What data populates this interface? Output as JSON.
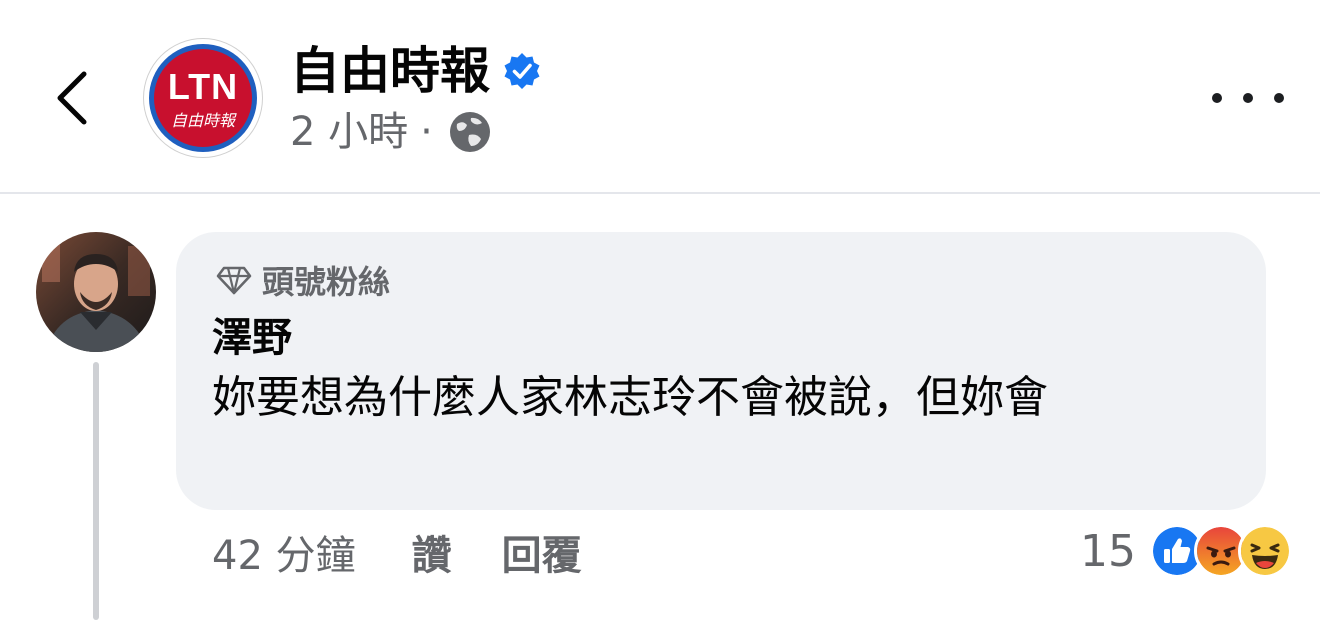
{
  "header": {
    "page_name": "自由時報",
    "logo_main": "LTN",
    "logo_sub": "自由時報",
    "post_time": "2 小時",
    "meta_separator": "·",
    "icons": {
      "back": "chevron-left-icon",
      "verified": "verified-badge-icon",
      "privacy": "globe-icon",
      "more": "more-dots-icon"
    },
    "colors": {
      "verified": "#1877f2",
      "logo_red": "#c8102e",
      "logo_ring": "#1f5fbf"
    }
  },
  "comment": {
    "badge_label": "頭號粉絲",
    "badge_icon": "diamond-icon",
    "author": "澤野",
    "text": "妳要想為什麼人家林志玲不會被說，但妳會",
    "time": "42 分鐘",
    "like_label": "讚",
    "reply_label": "回覆",
    "reaction_count": "15",
    "reactions": [
      "like-reaction-icon",
      "angry-reaction-icon",
      "haha-reaction-icon"
    ]
  }
}
